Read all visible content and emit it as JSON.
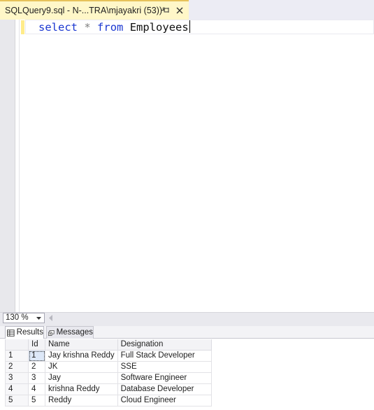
{
  "tab": {
    "title": "SQLQuery9.sql - N-...TRA\\mjayakri (53))*"
  },
  "editor": {
    "keyword_select": "select",
    "operator_star": "*",
    "keyword_from": "from",
    "table_name": "Employees"
  },
  "zoom": {
    "value": "130 %"
  },
  "results_tabs": {
    "results_label": "Results",
    "messages_label": "Messages"
  },
  "grid": {
    "columns": [
      "Id",
      "Name",
      "Designation"
    ],
    "rows": [
      {
        "row": "1",
        "id": "1",
        "name": "Jay krishna Reddy",
        "designation": "Full Stack Developer"
      },
      {
        "row": "2",
        "id": "2",
        "name": "JK",
        "designation": "SSE"
      },
      {
        "row": "3",
        "id": "3",
        "name": "Jay",
        "designation": "Software Engineer"
      },
      {
        "row": "4",
        "id": "4",
        "name": "krishna Reddy",
        "designation": "Database Developer"
      },
      {
        "row": "5",
        "id": "5",
        "name": "Reddy",
        "designation": "Cloud Engineer"
      }
    ]
  },
  "colors": {
    "tab_background": "#fff7c8",
    "keyword": "#1b37d1",
    "operator": "#808080"
  },
  "icons": [
    "pin-icon",
    "close-icon",
    "grid-icon",
    "messages-icon",
    "scroll-left-icon",
    "dropdown-arrow-icon"
  ]
}
